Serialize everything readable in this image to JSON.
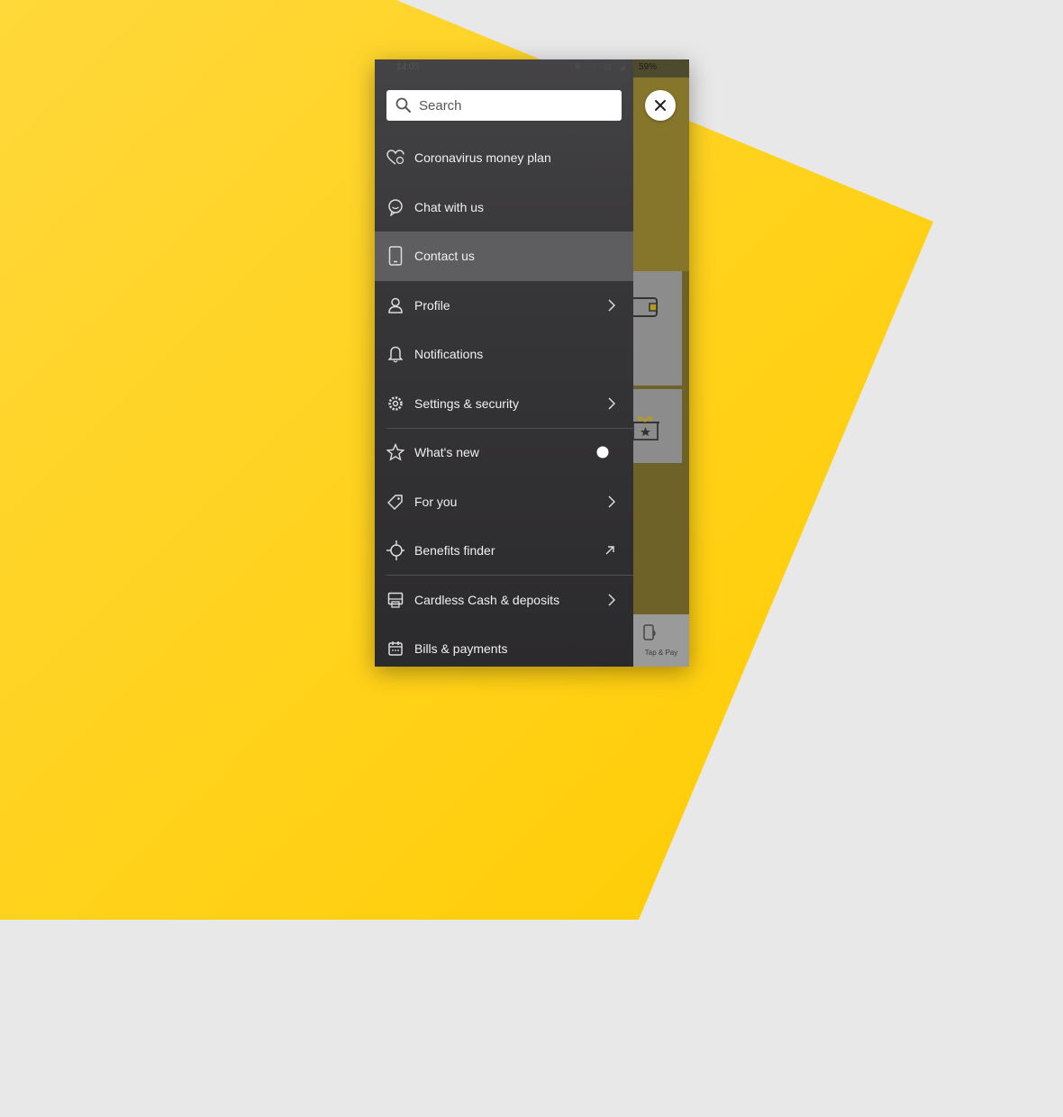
{
  "status_bar": {
    "time": "14:05",
    "battery": "59%"
  },
  "search": {
    "placeholder": "Search"
  },
  "menu": {
    "items": [
      {
        "label": "Coronavirus money plan",
        "icon": "heart-icon"
      },
      {
        "label": "Chat with us",
        "icon": "chat-bubble-icon"
      },
      {
        "label": "Contact us",
        "icon": "phone-icon",
        "active": true
      },
      {
        "label": "Profile",
        "icon": "person-icon",
        "trailing": "chevron-right-icon"
      },
      {
        "label": "Notifications",
        "icon": "bell-icon"
      },
      {
        "label": "Settings & security",
        "icon": "gear-icon",
        "trailing": "chevron-right-icon"
      },
      {
        "label": "What's new",
        "icon": "star-icon",
        "trailing": "unread-dot"
      },
      {
        "label": "For you",
        "icon": "tag-icon",
        "trailing": "chevron-right-icon"
      },
      {
        "label": "Benefits finder",
        "icon": "crosshair-icon",
        "trailing": "external-arrow-icon"
      },
      {
        "label": "Cardless Cash & deposits",
        "icon": "atm-icon",
        "trailing": "chevron-right-icon"
      },
      {
        "label": "Bills & payments",
        "icon": "calendar-icon"
      }
    ]
  },
  "background_app": {
    "tab_label": "Tap & Pay"
  },
  "colors": {
    "brand_yellow": "#FFD000",
    "drawer_bg": "#363537",
    "active_row": "#5e5d5f"
  }
}
